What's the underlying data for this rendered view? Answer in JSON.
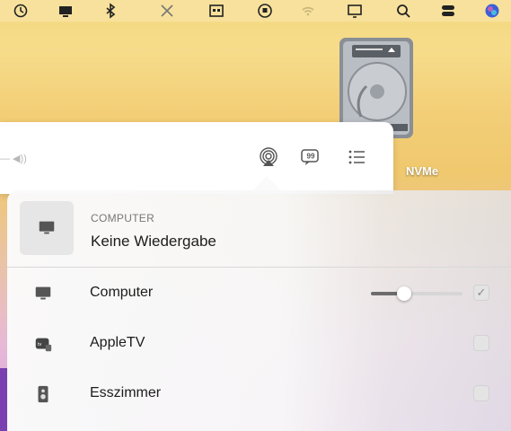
{
  "menubar": {
    "icons": [
      "time-machine-icon",
      "display-icon",
      "bluetooth-icon",
      "scissors-icon",
      "calendar-grid-icon",
      "vpn-icon",
      "wifi-icon",
      "screen-mirroring-icon",
      "search-icon",
      "control-center-icon",
      "siri-icon"
    ]
  },
  "desktop": {
    "disk_label": "NVMe"
  },
  "window": {
    "volume_glyph": "— ◀))",
    "buttons": [
      "airplay-icon",
      "lyrics-icon",
      "queue-icon"
    ]
  },
  "airplay": {
    "header_subtitle": "COMPUTER",
    "header_title": "Keine Wiedergabe",
    "devices": [
      {
        "label": "Computer",
        "checked": true,
        "volume": 0.36
      },
      {
        "label": "AppleTV",
        "checked": false
      },
      {
        "label": "Esszimmer",
        "checked": false
      }
    ],
    "check_glyph": "✓"
  }
}
